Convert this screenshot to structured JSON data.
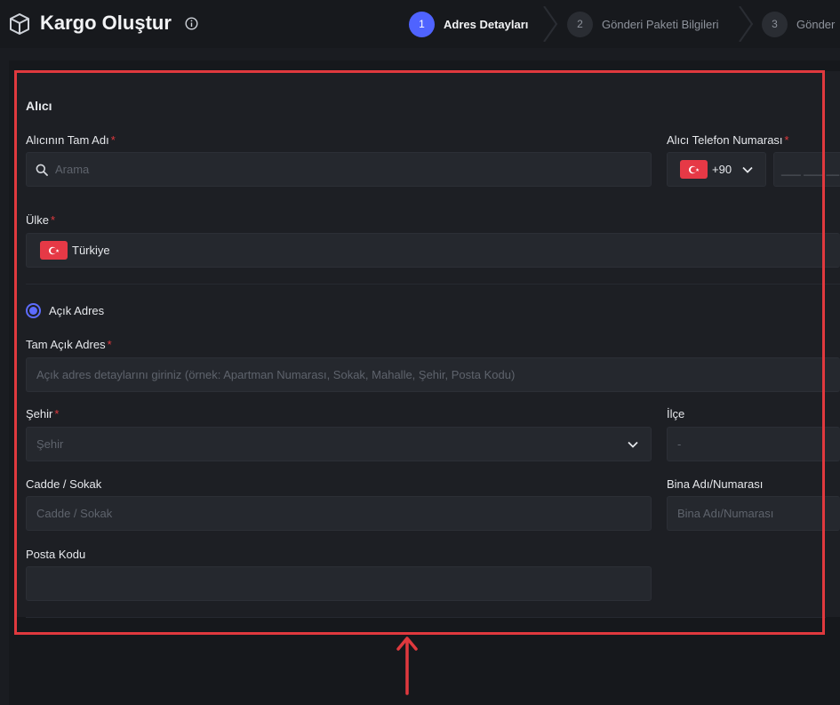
{
  "header": {
    "title": "Kargo Oluştur",
    "steps": [
      {
        "num": "1",
        "label": "Adres Detayları"
      },
      {
        "num": "2",
        "label": "Gönderi Paketi Bilgileri"
      },
      {
        "num": "3",
        "label": "Gönder"
      }
    ]
  },
  "form": {
    "section_title": "Alıcı",
    "recipient_name": {
      "label": "Alıcının Tam Adı",
      "required": "*",
      "placeholder": "Arama"
    },
    "phone": {
      "label": "Alıcı Telefon Numarası",
      "required": "*",
      "code": "+90",
      "placeholder": "___ ___ __ __"
    },
    "country": {
      "label": "Ülke",
      "required": "*",
      "value": "Türkiye"
    },
    "address_type": {
      "label": "Açık Adres"
    },
    "full_address": {
      "label": "Tam Açık Adres",
      "required": "*",
      "placeholder": "Açık adres detaylarını giriniz (örnek: Apartman Numarası, Sokak, Mahalle, Şehir, Posta Kodu)"
    },
    "city": {
      "label": "Şehir",
      "required": "*",
      "placeholder": "Şehir"
    },
    "district": {
      "label": "İlçe",
      "placeholder": "-"
    },
    "street": {
      "label": "Cadde / Sokak",
      "placeholder": "Cadde / Sokak"
    },
    "building": {
      "label": "Bina Adı/Numarası",
      "placeholder": "Bina Adı/Numarası"
    },
    "postal_code": {
      "label": "Posta Kodu",
      "value": ""
    }
  },
  "colors": {
    "accent": "#4f63ff",
    "required": "#e0393e",
    "highlight_border": "#e0393e",
    "flag": "#e63946"
  },
  "icons": [
    "box-icon",
    "info-icon",
    "search-icon",
    "turkey-flag-icon",
    "chevron-down-icon",
    "step-chevron-icon",
    "annotation-arrow-icon"
  ]
}
